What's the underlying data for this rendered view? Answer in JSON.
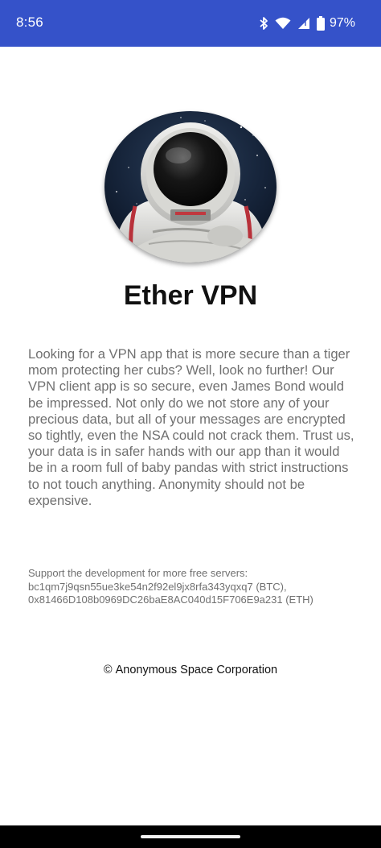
{
  "status_bar": {
    "time": "8:56",
    "battery_percent": "97%",
    "icons": [
      "bluetooth-icon",
      "wifi-icon",
      "cell-signal-icon",
      "battery-icon"
    ],
    "background_color": "#3552c9"
  },
  "app": {
    "logo_icon": "astronaut-avatar",
    "title": "Ether VPN",
    "description": "Looking for a VPN app that is more secure than a tiger mom protecting her cubs? Well, look no further! Our VPN client app is so secure, even James Bond would be impressed. Not only do we not store any of your precious data, but all of your messages are encrypted so tightly, even the NSA could not crack them. Trust us, your data is in safer hands with our app than it would be in a room full of baby pandas with strict instructions to not touch anything. Anonymity should not be expensive."
  },
  "support": {
    "line1": "Support the development for more free servers:",
    "line2": "bc1qm7j9qsn55ue3ke54n2f92el9jx8rfa343yqxq7 (BTC),",
    "line3": "0x81466D108b0969DC26baE8AC040d15F706E9a231 (ETH)"
  },
  "footer": {
    "copyright_symbol": "©",
    "company": "Anonymous Space Corporation"
  }
}
